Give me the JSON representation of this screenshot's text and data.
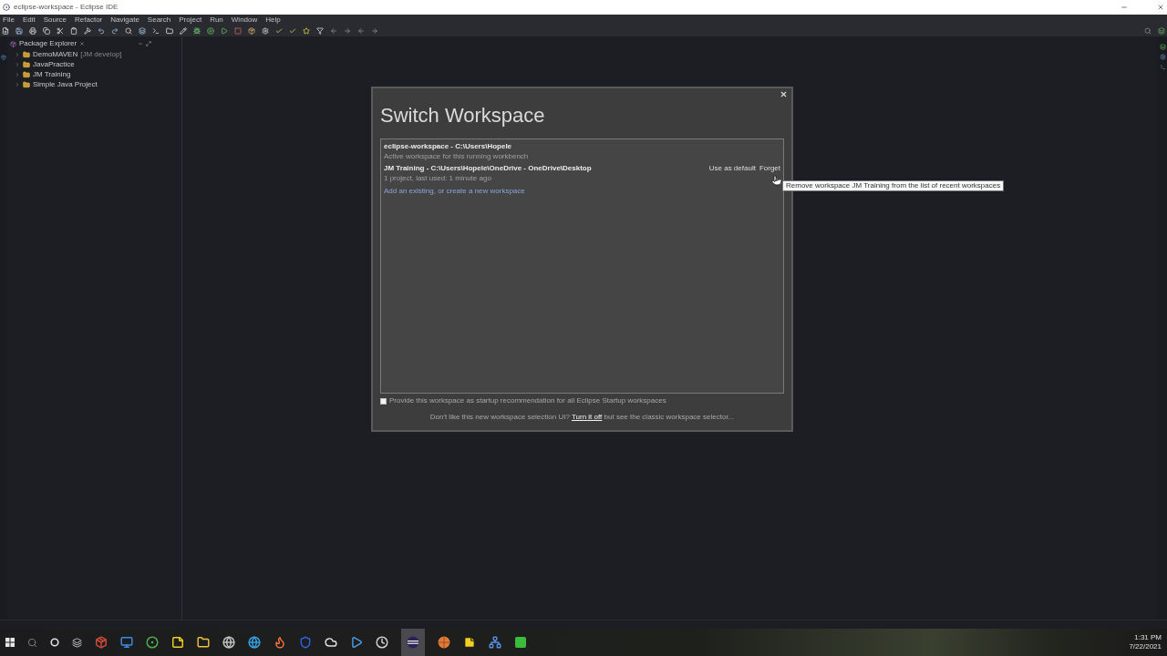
{
  "window": {
    "title": "eclipse-workspace - Eclipse IDE"
  },
  "menu": [
    "File",
    "Edit",
    "Source",
    "Refactor",
    "Navigate",
    "Search",
    "Project",
    "Run",
    "Window",
    "Help"
  ],
  "package_explorer": {
    "tab": "Package Explorer",
    "items": [
      {
        "label": "DemoMAVEN",
        "decoration": "[JM develop]",
        "expanded": false
      },
      {
        "label": "JavaPractice",
        "expanded": false
      },
      {
        "label": "JM Training",
        "expanded": false
      },
      {
        "label": "Simple Java Project",
        "expanded": false
      }
    ]
  },
  "dialog": {
    "title": "Switch Workspace",
    "workspaces": [
      {
        "name": "eclipse-workspace - C:\\Users\\Hopele",
        "detail": "Active workspace for this running workbench"
      },
      {
        "name": "JM Training - C:\\Users\\Hopele\\OneDrive - OneDrive\\Desktop",
        "detail": "1 project, last used: 1 minute ago",
        "actions": [
          "Use as default",
          "Forget"
        ]
      }
    ],
    "add_link": "Add an existing, or create a new workspace",
    "checkbox": {
      "label": "Provide this workspace as startup recommendation for all Eclipse Startup workspaces",
      "checked": false
    },
    "footer": {
      "before": "Don't like this new workspace selection UI?",
      "link": "Turn it off",
      "after": "but see the classic workspace selector..."
    }
  },
  "tooltip": "Remove workspace JM Training from the list of recent workspaces",
  "taskbar": {
    "time": "1:31 PM",
    "date": "7/22/2021"
  }
}
